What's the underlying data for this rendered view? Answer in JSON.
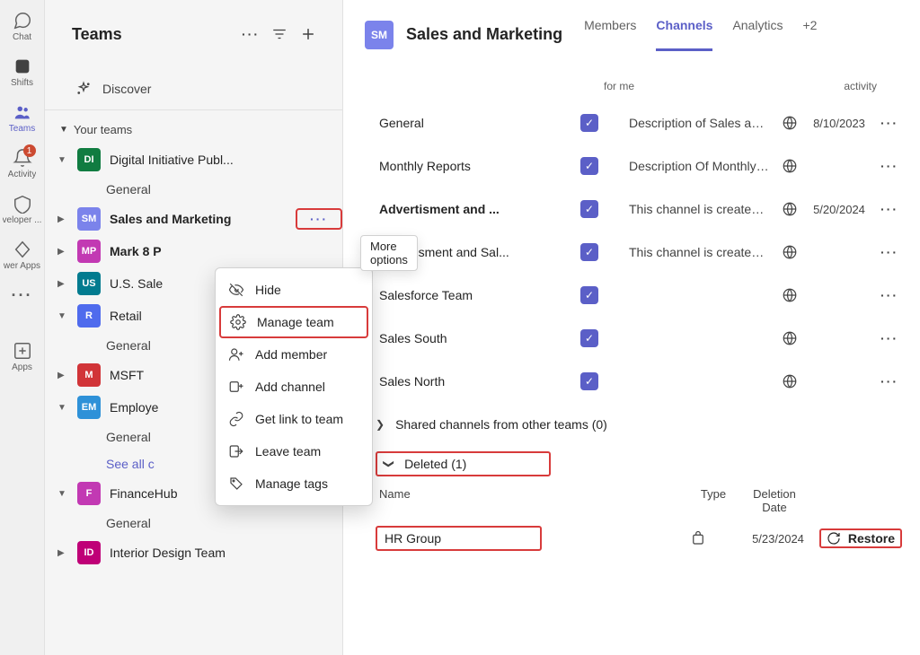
{
  "rail": {
    "items": [
      {
        "id": "chat",
        "label": "Chat"
      },
      {
        "id": "shifts",
        "label": "Shifts"
      },
      {
        "id": "teams",
        "label": "Teams",
        "selected": true
      },
      {
        "id": "activity",
        "label": "Activity",
        "badge": "1"
      },
      {
        "id": "developer",
        "label": "veloper ..."
      },
      {
        "id": "powerapps",
        "label": "wer Apps"
      },
      {
        "id": "more",
        "label": ""
      },
      {
        "id": "apps",
        "label": "Apps"
      }
    ]
  },
  "sidebar": {
    "title": "Teams",
    "discover": "Discover",
    "section_label": "Your teams",
    "see_all": "See all c",
    "teams": [
      {
        "initials": "DI",
        "color": "#107c41",
        "name": "Digital Initiative Publ...",
        "expanded": true,
        "bold": false,
        "channels": [
          "General"
        ]
      },
      {
        "initials": "SM",
        "color": "#7b83eb",
        "name": "Sales and Marketing",
        "expanded": false,
        "bold": true,
        "show_more": true
      },
      {
        "initials": "MP",
        "color": "#c239b3",
        "name": "Mark 8 P",
        "expanded": false,
        "bold": true
      },
      {
        "initials": "US",
        "color": "#027b8f",
        "name": "U.S. Sale",
        "expanded": false,
        "bold": false
      },
      {
        "initials": "R",
        "color": "#4f6bed",
        "name": "Retail",
        "expanded": true,
        "bold": false,
        "channels": [
          "General"
        ]
      },
      {
        "initials": "M",
        "color": "#d13438",
        "name": "MSFT",
        "expanded": false,
        "bold": false
      },
      {
        "initials": "EM",
        "color": "#2e91d8",
        "name": "Employe",
        "expanded": true,
        "bold": false,
        "channels": [
          "General"
        ],
        "show_see_all": true
      },
      {
        "initials": "F",
        "color": "#c239b3",
        "name": "FinanceHub",
        "expanded": true,
        "bold": false,
        "channels": [
          "General"
        ]
      },
      {
        "initials": "ID",
        "color": "#bf0077",
        "name": "Interior Design Team",
        "expanded": false,
        "bold": false
      }
    ]
  },
  "ctx_tooltip": "More options",
  "ctx_menu": {
    "items": [
      {
        "id": "hide",
        "label": "Hide"
      },
      {
        "id": "manage",
        "label": "Manage team",
        "highlight": true
      },
      {
        "id": "add_member",
        "label": "Add member"
      },
      {
        "id": "add_channel",
        "label": "Add channel"
      },
      {
        "id": "get_link",
        "label": "Get link to team"
      },
      {
        "id": "leave",
        "label": "Leave team"
      },
      {
        "id": "tags",
        "label": "Manage tags"
      }
    ]
  },
  "main": {
    "avatar": "SM",
    "title": "Sales and Marketing",
    "tabs": [
      {
        "id": "members",
        "label": "Members"
      },
      {
        "id": "channels",
        "label": "Channels",
        "selected": true
      },
      {
        "id": "analytics",
        "label": "Analytics"
      },
      {
        "id": "overflow",
        "label": "+2"
      }
    ],
    "col_heads": {
      "for_me": "for me",
      "activity": "activity"
    },
    "channels": [
      {
        "name": "General",
        "checked": true,
        "desc": "Description of Sales and ...",
        "date": "8/10/2023"
      },
      {
        "name": "Monthly Reports",
        "checked": true,
        "desc": "Description Of Monthly R..."
      },
      {
        "name": "Advertisment and ...",
        "checked": true,
        "desc": "This channel is created fo...",
        "date": "5/20/2024",
        "bold": true
      },
      {
        "name": "Advertisment and Sal...",
        "checked": true,
        "desc": "This channel is created fo..."
      },
      {
        "name": "Salesforce Team",
        "checked": true,
        "desc": ""
      },
      {
        "name": "Sales South",
        "checked": true,
        "desc": ""
      },
      {
        "name": "Sales North",
        "checked": true,
        "desc": ""
      }
    ],
    "shared_group": "Shared channels from other teams (0)",
    "deleted_group": "Deleted (1)",
    "deleted_cols": {
      "name": "Name",
      "type": "Type",
      "date": "Deletion Date"
    },
    "deleted_rows": [
      {
        "name": "HR Group",
        "date": "5/23/2024"
      }
    ],
    "restore_label": "Restore"
  }
}
